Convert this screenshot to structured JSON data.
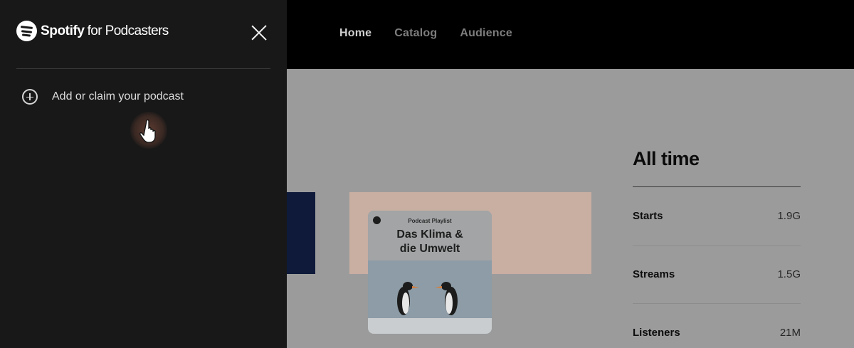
{
  "nav": {
    "items": [
      {
        "label": "Home",
        "active": true
      },
      {
        "label": "Catalog",
        "active": false
      },
      {
        "label": "Audience",
        "active": false
      }
    ]
  },
  "drawer": {
    "brand": {
      "name": "Spotify",
      "suffix": "for Podcasters"
    },
    "menu": {
      "add_label": "Add or claim your podcast"
    }
  },
  "cover": {
    "kicker": "Podcast Playlist",
    "title_line1": "Das Klima &",
    "title_line2": "die Umwelt"
  },
  "stats": {
    "title": "All time",
    "rows": [
      {
        "label": "Starts",
        "value": "1.9G"
      },
      {
        "label": "Streams",
        "value": "1.5G"
      },
      {
        "label": "Listeners",
        "value": "21M"
      }
    ]
  },
  "colors": {
    "drawer_bg": "#181818",
    "overlay_bg": "#9b9b9b",
    "topbar_bg": "#000000"
  }
}
